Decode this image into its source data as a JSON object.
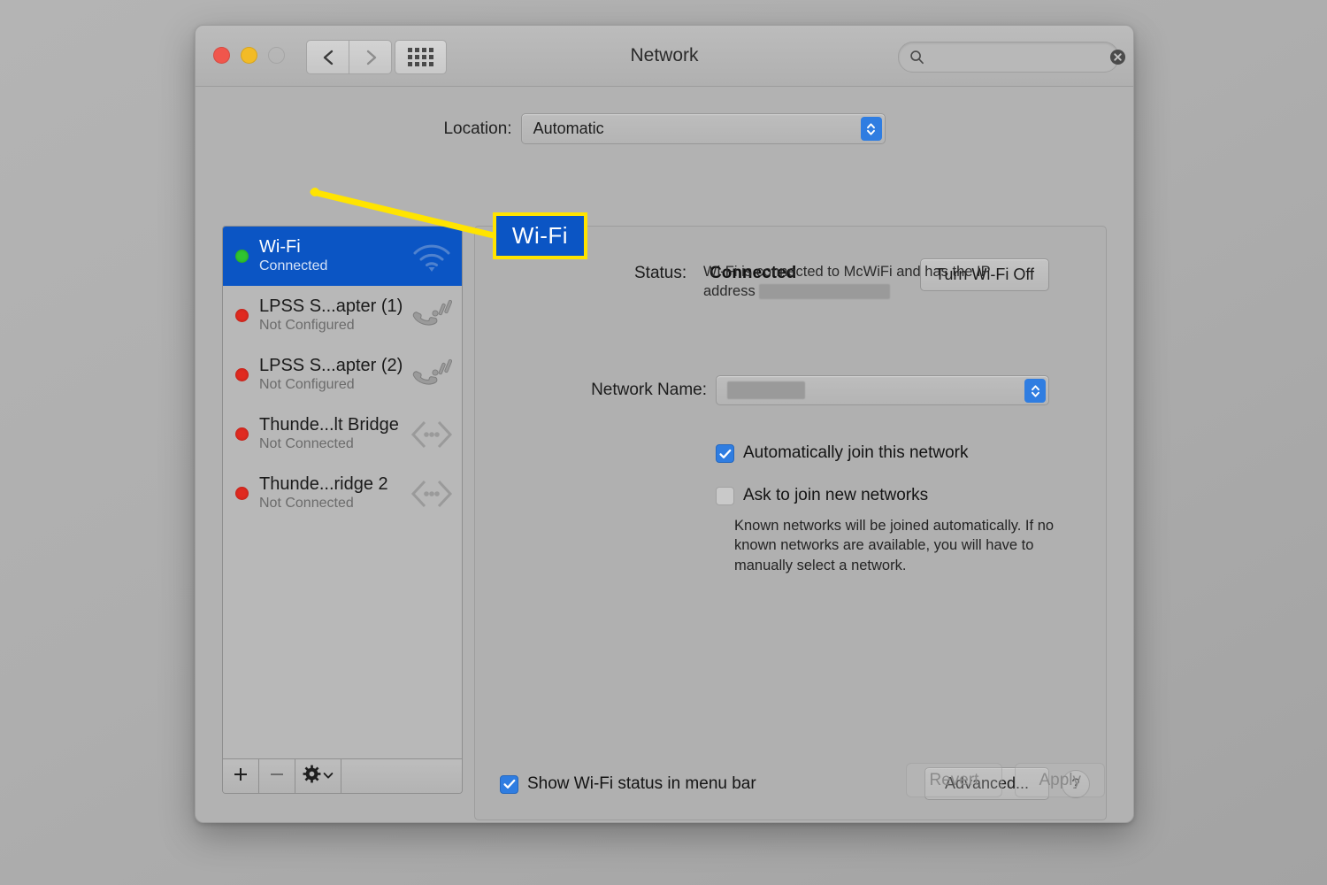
{
  "window": {
    "title": "Network",
    "traffic_lights": [
      "close-button",
      "minimize-button",
      "zoom-button"
    ],
    "nav": {
      "back": "back-icon",
      "forward": "forward-icon",
      "grid": "all-preferences-icon"
    }
  },
  "search": {
    "value": "",
    "placeholder": "",
    "icon": "search-icon",
    "clear_icon": "clear-icon"
  },
  "location": {
    "label": "Location:",
    "value": "Automatic"
  },
  "sidebar": {
    "services": [
      {
        "name": "Wi-Fi",
        "status": "Connected",
        "dot": "green",
        "icon": "wifi-icon",
        "selected": true
      },
      {
        "name": "LPSS S...apter (1)",
        "status": "Not Configured",
        "dot": "red",
        "icon": "modem-icon",
        "selected": false
      },
      {
        "name": "LPSS S...apter (2)",
        "status": "Not Configured",
        "dot": "red",
        "icon": "modem-icon",
        "selected": false
      },
      {
        "name": "Thunde...lt Bridge",
        "status": "Not Connected",
        "dot": "red",
        "icon": "thunderbolt-bridge-icon",
        "selected": false
      },
      {
        "name": "Thunde...ridge 2",
        "status": "Not Connected",
        "dot": "red",
        "icon": "thunderbolt-bridge-icon",
        "selected": false
      }
    ],
    "toolbar": {
      "add": "+",
      "remove": "−",
      "actions": "gear-icon"
    }
  },
  "panel": {
    "status_label": "Status:",
    "status_value": "Connected",
    "turn_wifi_button": "Turn Wi-Fi Off",
    "status_desc_before": "Wi-Fi is connected to McWiFi and has the IP address",
    "status_desc_redacted": true,
    "network_name_label": "Network Name:",
    "network_name_value": "",
    "network_name_redacted": true,
    "checkbox_auto_join": {
      "label": "Automatically join this network",
      "checked": true
    },
    "checkbox_ask_join": {
      "label": "Ask to join new networks",
      "checked": false
    },
    "join_help": "Known networks will be joined automatically. If no known networks are available, you will have to manually select a network.",
    "show_status_checkbox": {
      "label": "Show Wi-Fi status in menu bar",
      "checked": true
    },
    "advanced_button": "Advanced...",
    "help_button": "?"
  },
  "footer": {
    "revert_button": "Revert",
    "apply_button": "Apply",
    "disabled": true
  },
  "annotation": {
    "callout_text": "Wi-Fi",
    "box_color": "#0b55c4",
    "border_color": "#ffe400",
    "line_color": "#ffe400"
  }
}
